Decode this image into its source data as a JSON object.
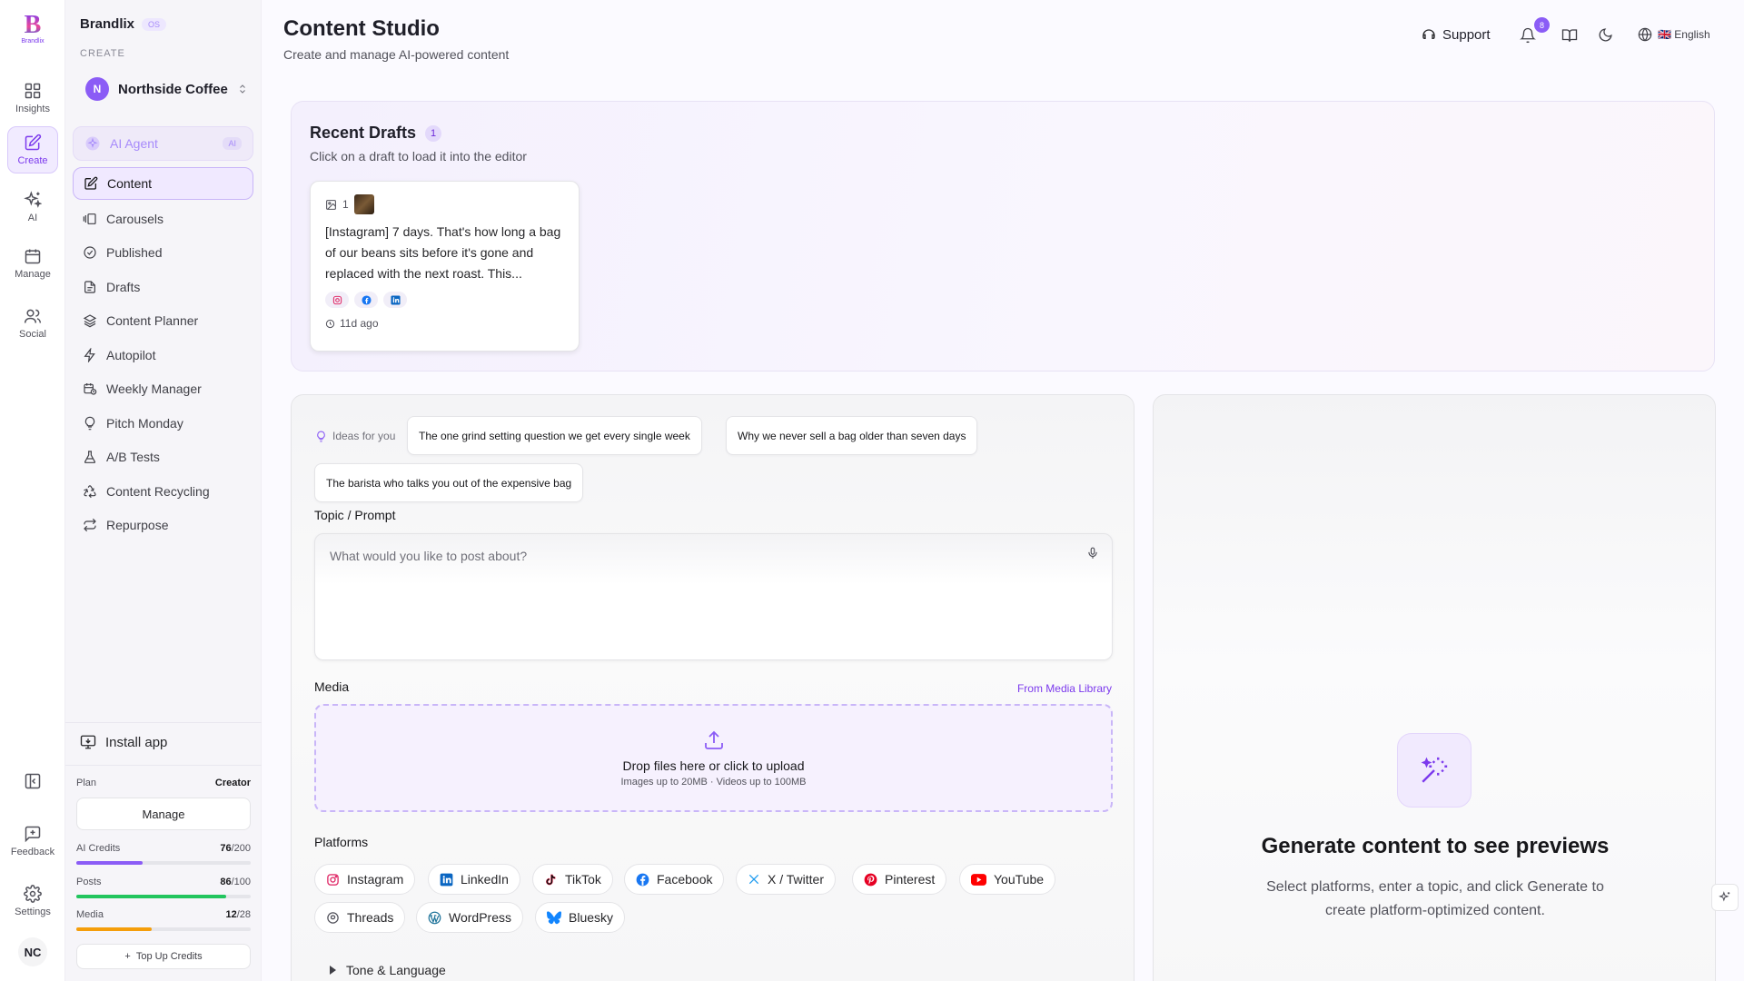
{
  "rail": {
    "logo_letter": "B",
    "logo_text": "Brandlix",
    "items": [
      {
        "label": "Insights",
        "icon": "grid-icon"
      },
      {
        "label": "Create",
        "icon": "edit-icon"
      },
      {
        "label": "AI",
        "icon": "sparkles-icon"
      },
      {
        "label": "Manage",
        "icon": "calendar-icon"
      },
      {
        "label": "Social",
        "icon": "users-icon"
      }
    ],
    "feedback_label": "Feedback",
    "settings_label": "Settings",
    "avatar_initials": "NC"
  },
  "sidebar": {
    "brand": "Brandlix",
    "brand_badge": "OS",
    "section_label": "CREATE",
    "business_initial": "N",
    "business_name": "Northside Coffee",
    "ai_agent_label": "AI Agent",
    "ai_agent_badge": "AI",
    "items": [
      {
        "label": "Content",
        "icon": "edit-icon"
      },
      {
        "label": "Carousels",
        "icon": "carousel-icon"
      },
      {
        "label": "Published",
        "icon": "check-circle-icon"
      },
      {
        "label": "Drafts",
        "icon": "file-icon"
      },
      {
        "label": "Content Planner",
        "icon": "layers-icon"
      },
      {
        "label": "Autopilot",
        "icon": "zap-icon"
      },
      {
        "label": "Weekly Manager",
        "icon": "calendar-clock-icon"
      },
      {
        "label": "Pitch Monday",
        "icon": "lightbulb-icon"
      },
      {
        "label": "A/B Tests",
        "icon": "flask-icon"
      },
      {
        "label": "Content Recycling",
        "icon": "recycle-icon"
      },
      {
        "label": "Repurpose",
        "icon": "repeat-icon"
      }
    ],
    "install_label": "Install app",
    "plan_label": "Plan",
    "plan_value": "Creator",
    "manage_label": "Manage",
    "usage": [
      {
        "label": "AI Credits",
        "used": "76",
        "total": "/200",
        "fraction": 0.38,
        "color": "#8b5cf6"
      },
      {
        "label": "Posts",
        "used": "86",
        "total": "/100",
        "fraction": 0.86,
        "color": "#22c55e"
      },
      {
        "label": "Media",
        "used": "12",
        "total": "/28",
        "fraction": 0.43,
        "color": "#f59e0b"
      }
    ],
    "topup_label": "Top Up Credits"
  },
  "header": {
    "title": "Content Studio",
    "subtitle": "Create and manage AI-powered content",
    "support_label": "Support",
    "notification_count": "8",
    "language_label": "🇬🇧 English"
  },
  "drafts": {
    "title": "Recent Drafts",
    "count": "1",
    "subtitle": "Click on a draft to load it into the editor",
    "card": {
      "image_count": "1",
      "text": "[Instagram] 7 days. That's how long a bag of our beans sits before it's gone and replaced with the next roast. This...",
      "time": "11d ago"
    }
  },
  "editor": {
    "ideas_label": "Ideas for you",
    "ideas": [
      "The one grind setting question we get every single week",
      "Why we never sell a bag older than seven days",
      "The barista who talks you out of the expensive bag"
    ],
    "topic_label": "Topic / Prompt",
    "topic_placeholder": "What would you like to post about?",
    "media_label": "Media",
    "media_library_link": "From Media Library",
    "drop_main": "Drop files here or click to upload",
    "drop_sub": "Images up to 20MB · Videos up to 100MB",
    "platforms_label": "Platforms",
    "platforms": [
      {
        "label": "Instagram",
        "color": "#e1306c"
      },
      {
        "label": "LinkedIn",
        "color": "#0a66c2"
      },
      {
        "label": "TikTok",
        "color": "#111111"
      },
      {
        "label": "Facebook",
        "color": "#1877f2"
      },
      {
        "label": "X / Twitter",
        "color": "#1d9bf0"
      },
      {
        "label": "Pinterest",
        "color": "#e60023"
      },
      {
        "label": "YouTube",
        "color": "#ff0000"
      },
      {
        "label": "Threads",
        "color": "#52525b"
      },
      {
        "label": "WordPress",
        "color": "#21759b"
      },
      {
        "label": "Bluesky",
        "color": "#1185fe"
      }
    ],
    "tone_label": "Tone & Language"
  },
  "preview": {
    "title": "Generate content to see previews",
    "subtitle": "Select platforms, enter a topic, and click Generate to create platform-optimized content."
  },
  "colors": {
    "accent": "#7c3aed",
    "accent_light": "#f1ebff"
  }
}
